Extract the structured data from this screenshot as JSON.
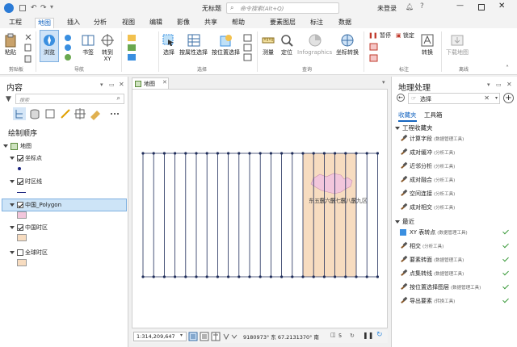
{
  "titlebar": {
    "title": "无标题",
    "search_placeholder": "命令搜索(Alt+Q)",
    "user": "未登录"
  },
  "ribbon_tabs": [
    "工程",
    "地图",
    "插入",
    "分析",
    "视图",
    "编辑",
    "影像",
    "共享",
    "帮助",
    "要素图层",
    "标注",
    "数据"
  ],
  "active_tab": "地图",
  "ribbon": {
    "clipboard": {
      "paste": "粘贴",
      "group": "剪贴板"
    },
    "navigate": {
      "explore": "浏览",
      "bookmarks": "书签",
      "goto_xy": "转到\nXY",
      "group": "导航"
    },
    "selection": {
      "select": "选择",
      "by_attributes": "按属性选择",
      "by_location": "按位置选择",
      "group": "选择"
    },
    "inquiry": {
      "measure": "测量",
      "locate": "定位",
      "infographics": "Infographics",
      "coord_conversion": "坐标转换",
      "group": "查询"
    },
    "labeling": {
      "pause": "暂停",
      "lock": "锁定",
      "convert": "转换",
      "group": "标注"
    },
    "offline": {
      "download": "下载地图",
      "group": "离线"
    }
  },
  "contents": {
    "title": "内容",
    "search_placeholder": "搜索",
    "drawing_order": "绘制顺序",
    "map": "地图",
    "layers": [
      {
        "name": "坐标点",
        "checked": true
      },
      {
        "name": "时区线",
        "checked": true
      },
      {
        "name": "中国_Polygon",
        "checked": true
      },
      {
        "name": "中国时区",
        "checked": true
      },
      {
        "name": "全球时区",
        "checked": false
      }
    ]
  },
  "map_view": {
    "tab": "地图",
    "zone_labels": [
      "东五区",
      "东六区",
      "东七区",
      "东八区",
      "东九区"
    ],
    "scale": "1:314,209,647",
    "coords": "9180973° 东 67.2131370° 南",
    "selected": "5"
  },
  "geoprocessing": {
    "title": "地理处理",
    "search_value": "选择",
    "tabs": [
      "收藏夹",
      "工具箱"
    ],
    "project_favorites": "工程收藏夹",
    "favorites": [
      {
        "name": "计算字段",
        "sub": "(数据管理工具)"
      },
      {
        "name": "成对缓冲",
        "sub": "(分析工具)"
      },
      {
        "name": "近邻分析",
        "sub": "(分析工具)"
      },
      {
        "name": "成对融合",
        "sub": "(分析工具)"
      },
      {
        "name": "空间连接",
        "sub": "(分析工具)"
      },
      {
        "name": "成对相交",
        "sub": "(分析工具)"
      }
    ],
    "recent_label": "最近",
    "recent": [
      {
        "name": "XY 表转点",
        "sub": "(数据管理工具)"
      },
      {
        "name": "相交",
        "sub": "(分析工具)"
      },
      {
        "name": "要素转面",
        "sub": "(数据管理工具)"
      },
      {
        "name": "点集转线",
        "sub": "(数据管理工具)"
      },
      {
        "name": "按位置选择图层",
        "sub": "(数据管理工具)"
      },
      {
        "name": "导出要素",
        "sub": "(转换工具)"
      }
    ]
  },
  "colors": {
    "accent": "#1565c0",
    "zone_fill": "#f7dcc0",
    "china_fill": "#f2c6dc",
    "line": "#1f2d5a"
  }
}
